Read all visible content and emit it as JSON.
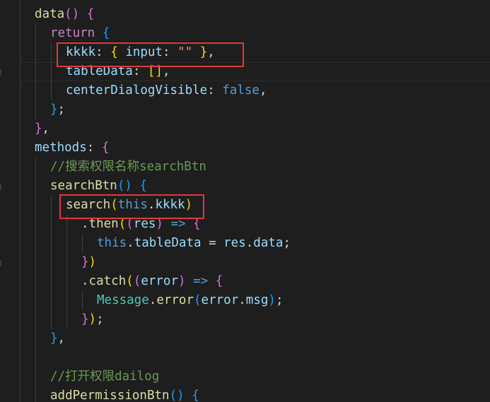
{
  "editor": {
    "language": "javascript",
    "lines": [
      {
        "top_text": ""
      },
      {
        "t": [
          [
            "fn",
            "data"
          ],
          [
            "b2",
            "()"
          ],
          [
            "pun",
            " "
          ],
          [
            "b2",
            "{"
          ]
        ]
      },
      {
        "t": [
          [
            "kw",
            "return"
          ],
          [
            "pun",
            " "
          ],
          [
            "b3",
            "{"
          ]
        ]
      },
      {
        "t": [
          [
            "var",
            "kkkk"
          ],
          [
            "pun",
            ": "
          ],
          [
            "b1",
            "{"
          ],
          [
            "pun",
            " "
          ],
          [
            "var",
            "input"
          ],
          [
            "pun",
            ": "
          ],
          [
            "str",
            "\"\""
          ],
          [
            "pun",
            " "
          ],
          [
            "b1",
            "}"
          ],
          [
            "pun",
            ","
          ]
        ]
      },
      {
        "t": [
          [
            "var",
            "tableData"
          ],
          [
            "pun",
            ": "
          ],
          [
            "b1",
            "[]"
          ],
          [
            "pun",
            ","
          ]
        ]
      },
      {
        "t": [
          [
            "var",
            "centerDialogVisible"
          ],
          [
            "pun",
            ": "
          ],
          [
            "bool",
            "false"
          ],
          [
            "pun",
            ","
          ]
        ]
      },
      {
        "t": [
          [
            "b3",
            "}"
          ],
          [
            "pun",
            ";"
          ]
        ]
      },
      {
        "t": [
          [
            "b2",
            "}"
          ],
          [
            "pun",
            ","
          ]
        ]
      },
      {
        "t": [
          [
            "var",
            "methods"
          ],
          [
            "pun",
            ": "
          ],
          [
            "b2",
            "{"
          ]
        ]
      },
      {
        "t": [
          [
            "cmt",
            "//搜索权限名称searchBtn"
          ]
        ]
      },
      {
        "t": [
          [
            "fn",
            "searchBtn"
          ],
          [
            "b3",
            "()"
          ],
          [
            "pun",
            " "
          ],
          [
            "b3",
            "{"
          ]
        ]
      },
      {
        "t": [
          [
            "fn",
            "search"
          ],
          [
            "b1",
            "("
          ],
          [
            "this",
            "this"
          ],
          [
            "pun",
            "."
          ],
          [
            "var",
            "kkkk"
          ],
          [
            "b1",
            ")"
          ]
        ]
      },
      {
        "t": [
          [
            "pun",
            "."
          ],
          [
            "fn",
            "then"
          ],
          [
            "b1",
            "("
          ],
          [
            "b2",
            "("
          ],
          [
            "var",
            "res"
          ],
          [
            "b2",
            ")"
          ],
          [
            "pun",
            " "
          ],
          [
            "op",
            "=>"
          ],
          [
            "pun",
            " "
          ],
          [
            "b2",
            "{"
          ]
        ]
      },
      {
        "t": [
          [
            "this",
            "this"
          ],
          [
            "pun",
            "."
          ],
          [
            "var",
            "tableData"
          ],
          [
            "pun",
            " = "
          ],
          [
            "var",
            "res"
          ],
          [
            "pun",
            "."
          ],
          [
            "var",
            "data"
          ],
          [
            "pun",
            ";"
          ]
        ]
      },
      {
        "t": [
          [
            "b2",
            "}"
          ],
          [
            "b1",
            ")"
          ]
        ]
      },
      {
        "t": [
          [
            "pun",
            "."
          ],
          [
            "fn",
            "catch"
          ],
          [
            "b1",
            "("
          ],
          [
            "b2",
            "("
          ],
          [
            "var",
            "error"
          ],
          [
            "b2",
            ")"
          ],
          [
            "pun",
            " "
          ],
          [
            "op",
            "=>"
          ],
          [
            "pun",
            " "
          ],
          [
            "b2",
            "{"
          ]
        ]
      },
      {
        "t": [
          [
            "cls",
            "Message"
          ],
          [
            "pun",
            "."
          ],
          [
            "fn",
            "error"
          ],
          [
            "b3",
            "("
          ],
          [
            "var",
            "error"
          ],
          [
            "pun",
            "."
          ],
          [
            "var",
            "msg"
          ],
          [
            "b3",
            ")"
          ],
          [
            "pun",
            ";"
          ]
        ]
      },
      {
        "t": [
          [
            "b2",
            "}"
          ],
          [
            "b1",
            ")"
          ],
          [
            "pun",
            ";"
          ]
        ]
      },
      {
        "t": [
          [
            "b3",
            "}"
          ],
          [
            "pun",
            ","
          ]
        ]
      },
      {
        "t": []
      },
      {
        "t": [
          [
            "cmt",
            "//打开权限dailog"
          ]
        ]
      },
      {
        "t": [
          [
            "fn",
            "addPermissionBtn"
          ],
          [
            "b3",
            "()"
          ],
          [
            "pun",
            " "
          ],
          [
            "b3",
            "{"
          ]
        ]
      }
    ]
  }
}
